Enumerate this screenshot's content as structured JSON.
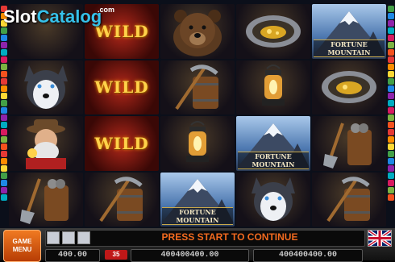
{
  "logo": {
    "slot": "Slot",
    "catalog": "Catalog",
    "dotcom": ".com"
  },
  "reels": {
    "wild_label": "WILD",
    "mountain_label": "FORTUNE MOUNTAIN",
    "cells": [
      [
        "logo-area",
        "wild",
        "bear",
        "gold-pan",
        "mountain"
      ],
      [
        "husky",
        "wild",
        "pickaxe-barrel",
        "lantern",
        "gold-pan"
      ],
      [
        "prospector",
        "wild",
        "lantern",
        "mountain",
        "shovel-barrel"
      ],
      [
        "shovel-barrel",
        "pickaxe-barrel",
        "mountain",
        "husky",
        "pickaxe-barrel"
      ]
    ]
  },
  "panel": {
    "menu_label_1": "GAME",
    "menu_label_2": "MENU",
    "message": "PRESS START TO CONTINUE",
    "credit": "400.00",
    "lines": "35",
    "bet": "400400400.00",
    "win": "400400400.00"
  },
  "colors": {
    "accent_orange": "#f26a1f",
    "wild_gold": "#ffd24a",
    "logo_blue": "#36c1ea"
  }
}
